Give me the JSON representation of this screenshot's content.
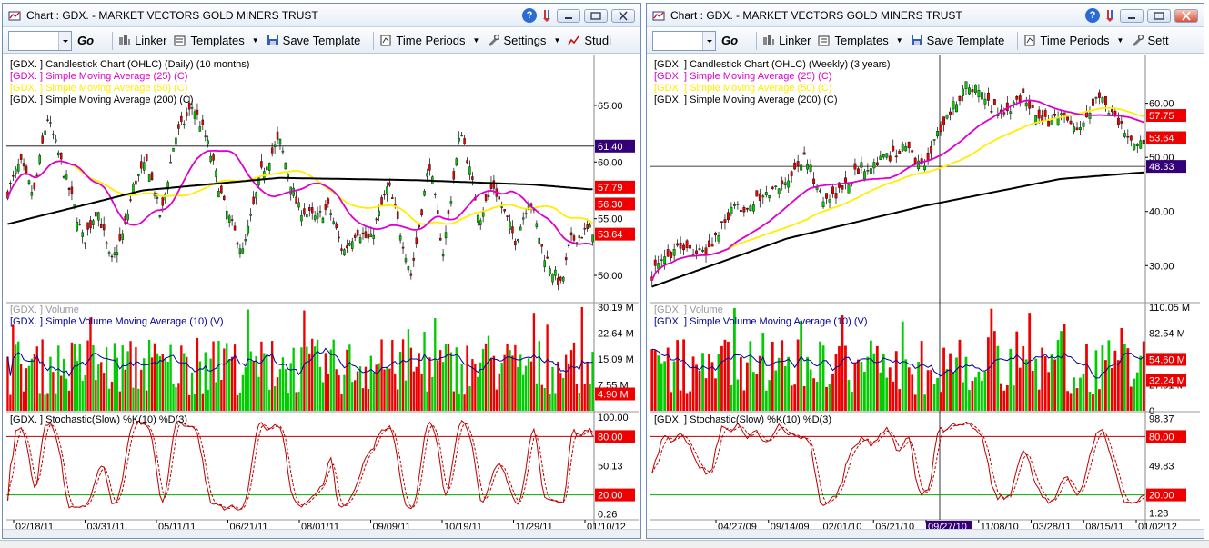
{
  "colors": {
    "up": "#00cc00",
    "down": "#ee0000",
    "sma25": "#dd00cc",
    "sma50": "#ffee00",
    "sma200": "#000000",
    "vol_avg": "#000099",
    "stoch_k": "#bb0000",
    "stoch_d": "#bb0000",
    "line80": "#bb0000",
    "line20": "#00aa00",
    "tag_purple": "#330077",
    "tag_red": "#ee0000",
    "tag_dkgray": "#777777"
  },
  "left": {
    "title": "Chart : GDX.  - MARKET VECTORS GOLD MINERS TRUST",
    "toolbar": {
      "go": "Go",
      "linker": "Linker",
      "templates": "Templates",
      "save_template": "Save Template",
      "time_periods": "Time Periods",
      "settings": "Settings",
      "studies": "Studi"
    },
    "price_legend": [
      "[GDX. ] Candlestick Chart (OHLC) (Daily) (10 months)",
      "[GDX. ] Simple Moving Average (25) (C)",
      "[GDX. ] Simple Moving Average (50) (C)",
      "[GDX. ] Simple Moving Average (200) (C)"
    ],
    "vol_legend": [
      "[GDX. ] Volume",
      "[GDX. ] Simple Volume Moving Average (10) (V)"
    ],
    "stoch_legend": "[GDX. ] Stochastic(Slow) %K(10) %D(3)",
    "price_ticks": [
      "65.00",
      "60.00",
      "55.00",
      "50.00"
    ],
    "vol_ticks": [
      "30.19 M",
      "22.64 M",
      "15.09 M",
      "7.55 M"
    ],
    "stoch_ticks": [
      "100.00",
      "50.13",
      "0.26"
    ],
    "tags": {
      "price": [
        "61.40",
        "57.79",
        "56.30",
        "53.64"
      ],
      "vol": "4.90 M",
      "stoch": [
        "80.00",
        "20.00"
      ]
    },
    "dates": [
      "02/18/11",
      "03/31/11",
      "05/11/11",
      "06/21/11",
      "08/01/11",
      "09/09/11",
      "10/19/11",
      "11/29/11",
      "01/10/12"
    ],
    "chart_data": {
      "type": "candlestick",
      "n": 220,
      "ylim": [
        48,
        69
      ],
      "vol_max": 30.19,
      "price_path": [
        [
          0,
          57
        ],
        [
          15,
          60
        ],
        [
          30,
          57
        ],
        [
          45,
          64
        ],
        [
          60,
          60
        ],
        [
          75,
          56
        ],
        [
          85,
          53
        ],
        [
          100,
          56
        ],
        [
          115,
          51
        ],
        [
          130,
          54
        ],
        [
          140,
          58
        ],
        [
          155,
          60
        ],
        [
          170,
          55
        ],
        [
          185,
          62
        ],
        [
          205,
          65
        ],
        [
          220,
          62
        ],
        [
          240,
          56
        ],
        [
          260,
          52
        ],
        [
          280,
          59
        ],
        [
          300,
          62
        ],
        [
          320,
          56
        ],
        [
          340,
          55
        ],
        [
          355,
          56
        ],
        [
          370,
          52
        ],
        [
          385,
          54
        ],
        [
          400,
          53
        ],
        [
          420,
          58
        ],
        [
          445,
          50
        ],
        [
          465,
          60
        ],
        [
          480,
          52
        ],
        [
          500,
          63
        ],
        [
          520,
          55
        ],
        [
          535,
          58
        ],
        [
          560,
          53
        ],
        [
          575,
          57
        ],
        [
          590,
          52
        ],
        [
          610,
          49
        ],
        [
          620,
          53
        ],
        [
          640,
          54
        ]
      ],
      "hline": 61.4,
      "sma200": [
        [
          0,
          54.5
        ],
        [
          150,
          57.5
        ],
        [
          300,
          58.6
        ],
        [
          450,
          58.4
        ],
        [
          580,
          58
        ],
        [
          640,
          57.6
        ]
      ]
    }
  },
  "right": {
    "title": "Chart : GDX.  - MARKET VECTORS GOLD MINERS TRUST",
    "toolbar": {
      "go": "Go",
      "linker": "Linker",
      "templates": "Templates",
      "save_template": "Save Template",
      "time_periods": "Time Periods",
      "settings": "Sett"
    },
    "price_legend": [
      "[GDX. ] Candlestick Chart (OHLC) (Weekly) (3 years)",
      "[GDX. ] Simple Moving Average (25) (C)",
      "[GDX. ] Simple Moving Average (50) (C)",
      "[GDX. ] Simple Moving Average (200) (C)"
    ],
    "vol_legend": [
      "[GDX. ] Volume",
      "[GDX. ] Simple Volume Moving Average (10) (V)"
    ],
    "stoch_legend": "[GDX. ] Stochastic(Slow) %K(10) %D(3)",
    "price_ticks": [
      "60.00",
      "50.00",
      "40.00",
      "30.00"
    ],
    "vol_ticks": [
      "110.05 M",
      "82.54 M",
      "55.03 M",
      "27.51 M",
      "0"
    ],
    "stoch_ticks": [
      "98.37",
      "49.83",
      "1.28"
    ],
    "tags": {
      "price": [
        "57.75",
        "53.64",
        "48.33"
      ],
      "vol": [
        "54.60 M",
        "32.24 M"
      ],
      "stoch": [
        "80.00",
        "20.00"
      ]
    },
    "dates": [
      "04/27/09",
      "09/14/09",
      "02/01/10",
      "06/21/10",
      "09/27/10",
      "11/08/10",
      "03/28/11",
      "08/15/11",
      "01/02/12"
    ],
    "chart_data": {
      "type": "candlestick",
      "n": 156,
      "ylim": [
        24,
        68
      ],
      "vol_max": 110.05,
      "price_path": [
        [
          0,
          28
        ],
        [
          30,
          34
        ],
        [
          60,
          32
        ],
        [
          90,
          40
        ],
        [
          120,
          42
        ],
        [
          150,
          46
        ],
        [
          170,
          50
        ],
        [
          190,
          42
        ],
        [
          210,
          44
        ],
        [
          230,
          48
        ],
        [
          260,
          50
        ],
        [
          280,
          52
        ],
        [
          300,
          48
        ],
        [
          320,
          56
        ],
        [
          350,
          64
        ],
        [
          370,
          60
        ],
        [
          390,
          58
        ],
        [
          410,
          62
        ],
        [
          430,
          56
        ],
        [
          450,
          58
        ],
        [
          470,
          54
        ],
        [
          490,
          62
        ],
        [
          510,
          58
        ],
        [
          530,
          52
        ],
        [
          550,
          54
        ],
        [
          570,
          62
        ],
        [
          590,
          56
        ],
        [
          600,
          58
        ],
        [
          610,
          54
        ],
        [
          630,
          60
        ],
        [
          660,
          60
        ],
        [
          690,
          54
        ],
        [
          720,
          52
        ],
        [
          750,
          58
        ],
        [
          780,
          56
        ],
        [
          800,
          53
        ],
        [
          820,
          48
        ],
        [
          840,
          58
        ],
        [
          860,
          52
        ],
        [
          880,
          54
        ],
        [
          900,
          60
        ],
        [
          920,
          55
        ],
        [
          940,
          57
        ],
        [
          960,
          54
        ]
      ],
      "hline": 48.33,
      "sma200": [
        [
          0,
          26
        ],
        [
          150,
          35
        ],
        [
          300,
          41
        ],
        [
          450,
          46
        ],
        [
          600,
          48
        ],
        [
          720,
          48.7
        ],
        [
          960,
          49
        ]
      ]
    }
  }
}
